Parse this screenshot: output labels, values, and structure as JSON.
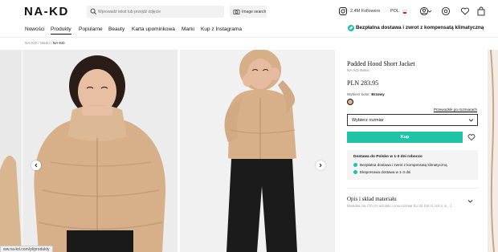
{
  "header": {
    "logo": "NA-KD",
    "search_placeholder": "Wprowadź tekst lub przejdź zdjęcie",
    "image_search_label": "Image search",
    "followers": "2.4M Followers",
    "language": "POL"
  },
  "nav": {
    "items": [
      "Nowości",
      "Produkty",
      "Popularne",
      "Beauty",
      "Karta upominkowa",
      "Marki",
      "Kup z Instagrama"
    ],
    "active_index": 1,
    "delivery_banner": "Bezpłatna dostawa i zwrot z kompensatą klimatyczną"
  },
  "breadcrumb": {
    "items": [
      "NA-KD",
      "Marki"
    ],
    "current": "NA-KD"
  },
  "product": {
    "title": "Padded Hood Short Jacket",
    "brand": "NA-KD Basic",
    "price": "PLN 283.95",
    "color_label": "Wybierz kolor:",
    "color_value": "Brzowy",
    "size_guide": "Przewodnik po rozmiarach",
    "size_placeholder": "Wybierz rozmiar",
    "buy_label": "Kup",
    "delivery_title": "Dostawa do Polsko w 1-3 dni roboczo",
    "delivery_lines": [
      "Bezpłatna dostawa i zwrot z kompensatą klimatyczną",
      "Ekspresowa dostawa w 1-3 dni"
    ],
    "desc_title": "Opis i skład materiału",
    "desc_text": "Modelka ma 170 cm wzrostu i nosi rozmiar EU 34 (UK 8, US 2, w ...)"
  },
  "status_url": "ww.na-kd.com/pl/produkty",
  "colors": {
    "accent": "#20c3a6",
    "jacket": "#d8b48c"
  }
}
